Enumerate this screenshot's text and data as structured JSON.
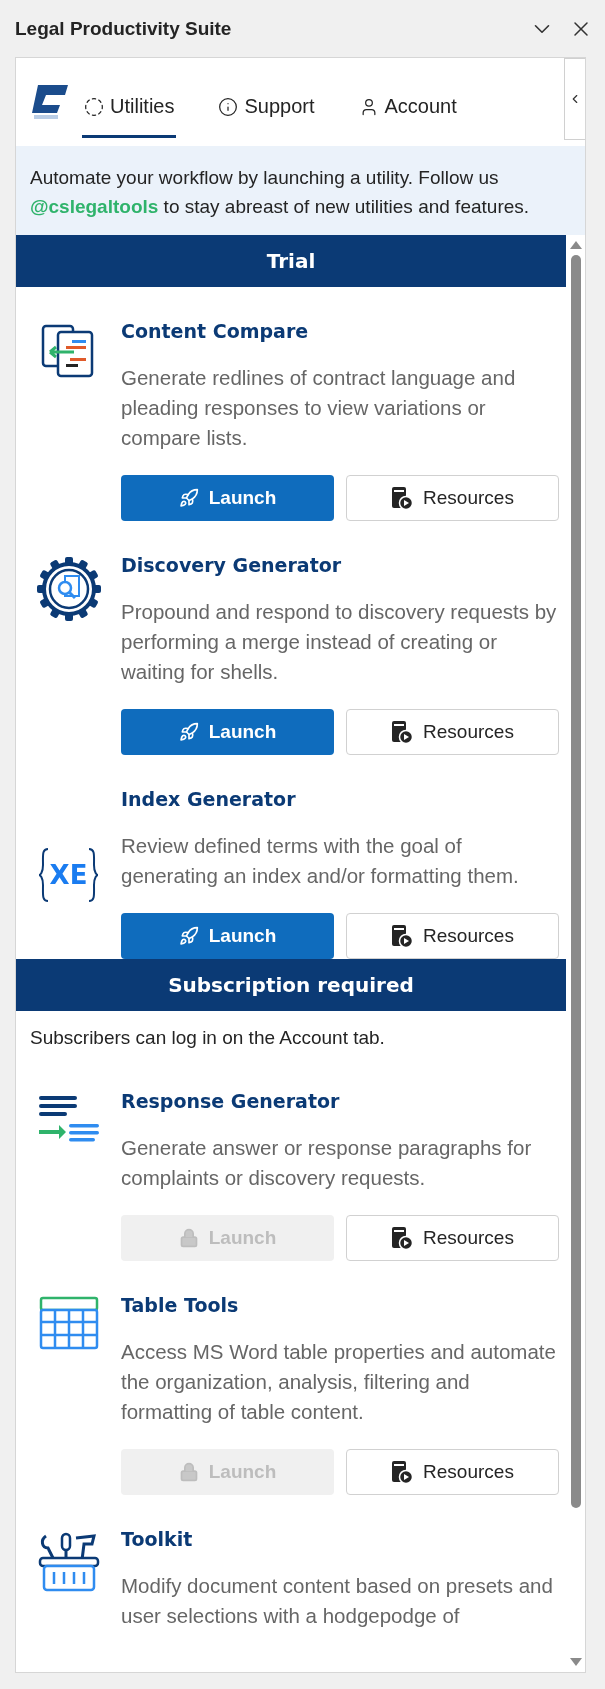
{
  "window": {
    "title": "Legal Productivity Suite"
  },
  "tabs": [
    {
      "label": "Utilities",
      "selected": true
    },
    {
      "label": "Support",
      "selected": false
    },
    {
      "label": "Account",
      "selected": false
    }
  ],
  "intro": {
    "text": "Automate your workflow by launching a utility. Follow us **@cslegaltools** to stay abreast of new utilities and features."
  },
  "sections": [
    {
      "title": "Trial",
      "utilities": [
        {
          "title": "Content Compare",
          "description": "Generate redlines of contract language and pleading responses to view variations or compare lists.",
          "launch": {
            "label": "Launch",
            "disabled": false
          },
          "resources": "Resources"
        },
        {
          "title": "Discovery Generator",
          "description": "Propound and respond to discovery requests by performing a merge instead of creating or waiting for shells.",
          "launch": {
            "label": "Launch",
            "disabled": false
          },
          "resources": "Resources"
        },
        {
          "title": "Index Generator",
          "icon_text": "XE",
          "description": "Review defined terms with the goal of generating an index and/or formatting them.",
          "launch": {
            "label": "Launch",
            "disabled": false
          },
          "resources": "Resources"
        }
      ]
    },
    {
      "title": "Subscription required",
      "note": "Subscribers can log in on the Account tab.",
      "utilities": [
        {
          "title": "Response Generator",
          "description": "Generate answer or response paragraphs for complaints or discovery requests.",
          "launch": {
            "label": "Launch",
            "disabled": true
          },
          "resources": "Resources"
        },
        {
          "title": "Table Tools",
          "description": "Access MS Word table properties and automate the organization, analysis, filtering and formatting of table content.",
          "launch": {
            "label": "Launch",
            "disabled": true
          },
          "resources": "Resources"
        },
        {
          "title": "Toolkit",
          "description": "Modify document content based on presets and user selections with a hodgepodge of"
        }
      ]
    }
  ]
}
